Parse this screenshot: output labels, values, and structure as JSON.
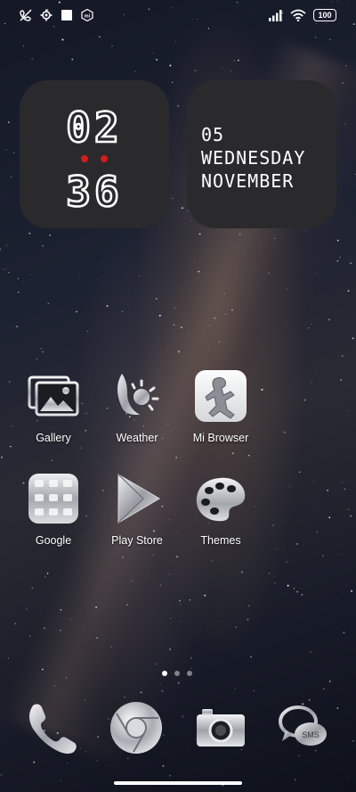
{
  "status_bar": {
    "battery": "100",
    "icons": [
      "no-call-icon",
      "settings-gear-icon",
      "notification-square-icon",
      "mi-icon",
      "signal-icon",
      "wifi-icon",
      "battery-icon"
    ]
  },
  "clock_widget": {
    "hours": "02",
    "minutes": "36",
    "separator_color": "#d51b1b"
  },
  "date_widget": {
    "day": "05",
    "weekday": "WEDNESDAY",
    "month": "NOVEMBER"
  },
  "apps": [
    {
      "label": "Gallery",
      "icon": "gallery-icon"
    },
    {
      "label": "Weather",
      "icon": "weather-icon"
    },
    {
      "label": "Mi Browser",
      "icon": "browser-icon"
    },
    {
      "label": "Google",
      "icon": "google-folder-icon"
    },
    {
      "label": "Play Store",
      "icon": "play-store-icon"
    },
    {
      "label": "Themes",
      "icon": "themes-palette-icon"
    }
  ],
  "pager": {
    "pages": 3,
    "active": 1
  },
  "dock": [
    "phone-icon",
    "chrome-icon",
    "camera-icon",
    "sms-icon"
  ],
  "dock_sms_label": "SMS"
}
